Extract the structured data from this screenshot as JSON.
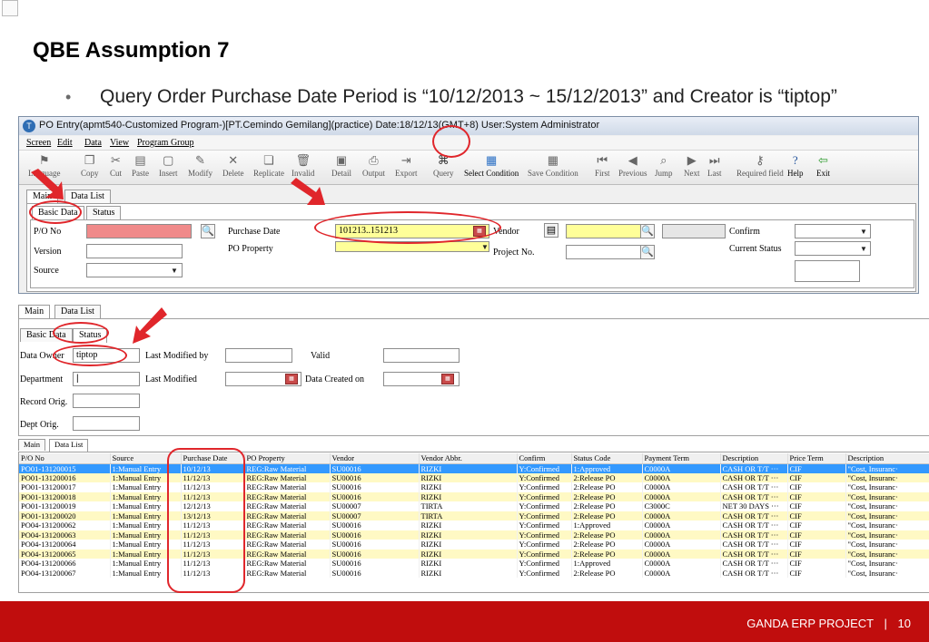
{
  "slide": {
    "title": "QBE Assumption 7",
    "bullet": "Query Order Purchase Date Period is “10/12/2013 ~ 15/12/2013” and Creator is “tiptop”",
    "footer_project": "GANDA ERP PROJECT",
    "page_number": "10"
  },
  "window": {
    "title": "PO Entry(apmt540-Customized Program-)[PT.Cemindo Gemilang](practice) Date:18/12/13(GMT+8) User:System Administrator",
    "menu": [
      "Screen",
      "Edit",
      "Data",
      "View",
      "Program Group"
    ],
    "toolbar": [
      {
        "label": "Language",
        "icon": "flag-icon"
      },
      {
        "label": "Copy",
        "icon": "copy-icon"
      },
      {
        "label": "Cut",
        "icon": "cut-icon"
      },
      {
        "label": "Paste",
        "icon": "paste-icon"
      },
      {
        "label": "Insert",
        "icon": "insert-icon"
      },
      {
        "label": "Modify",
        "icon": "pencil-icon"
      },
      {
        "label": "Delete",
        "icon": "delete-icon"
      },
      {
        "label": "Replicate",
        "icon": "replicate-icon"
      },
      {
        "label": "Invalid",
        "icon": "trash-icon"
      },
      {
        "label": "Detail",
        "icon": "detail-icon"
      },
      {
        "label": "Output",
        "icon": "printer-icon"
      },
      {
        "label": "Export",
        "icon": "export-icon"
      },
      {
        "label": "Query",
        "icon": "binoculars-icon"
      },
      {
        "label": "Select Condition",
        "icon": "select-condition-icon"
      },
      {
        "label": "Save Condition",
        "icon": "save-condition-icon"
      },
      {
        "label": "First",
        "icon": "first-icon"
      },
      {
        "label": "Previous",
        "icon": "previous-icon"
      },
      {
        "label": "Jump",
        "icon": "jump-icon"
      },
      {
        "label": "Next",
        "icon": "next-icon"
      },
      {
        "label": "Last",
        "icon": "last-icon"
      },
      {
        "label": "Required field",
        "icon": "key-icon"
      },
      {
        "label": "Help",
        "icon": "help-icon"
      },
      {
        "label": "Exit",
        "icon": "exit-icon"
      }
    ],
    "tabs": {
      "main": "Main",
      "data_list": "Data List"
    },
    "subtabs": {
      "basic": "Basic Data",
      "status": "Status"
    },
    "basic": {
      "po_no_label": "P/O No",
      "version_label": "Version",
      "source_label": "Source",
      "purchase_date_label": "Purchase Date",
      "purchase_date_value": "101213..151213",
      "po_property_label": "PO Property",
      "vendor_label": "Vendor",
      "project_label": "Project No.",
      "confirm_label": "Confirm",
      "current_status_label": "Current Status"
    }
  },
  "status_panel": {
    "tabs": {
      "main": "Main",
      "data_list": "Data List"
    },
    "subtabs": {
      "basic": "Basic Data",
      "status": "Status"
    },
    "data_owner_label": "Data Owner",
    "data_owner_value": "tiptop",
    "last_modified_by_label": "Last Modified by",
    "valid_label": "Valid",
    "department_label": "Department",
    "last_modified_label": "Last Modified",
    "data_created_label": "Data Created on",
    "record_orig_label": "Record Orig.",
    "dept_orig_label": "Dept Orig."
  },
  "data_list": {
    "tabs": {
      "main": "Main",
      "data_list": "Data List"
    },
    "columns": [
      "P/O No",
      "Source",
      "Purchase Date",
      "PO Property",
      "Vendor",
      "Vendor Abbr.",
      "Confirm",
      "Status Code",
      "Payment Term",
      "Description",
      "Price Term",
      "Description"
    ],
    "rows": [
      [
        "PO01-131200015",
        "1:Manual Entry",
        "10/12/13",
        "REG:Raw Material",
        "SU00016",
        "RIZKI",
        "Y:Confirmed",
        "1:Approved",
        "C0000A",
        "CASH OR T/T ···",
        "CIF",
        "\"Cost, Insuranc·"
      ],
      [
        "PO01-131200016",
        "1:Manual Entry",
        "11/12/13",
        "REG:Raw Material",
        "SU00016",
        "RIZKI",
        "Y:Confirmed",
        "2:Release PO",
        "C0000A",
        "CASH OR T/T ···",
        "CIF",
        "\"Cost, Insuranc·"
      ],
      [
        "PO01-131200017",
        "1:Manual Entry",
        "11/12/13",
        "REG:Raw Material",
        "SU00016",
        "RIZKI",
        "Y:Confirmed",
        "2:Release PO",
        "C0000A",
        "CASH OR T/T ···",
        "CIF",
        "\"Cost, Insuranc·"
      ],
      [
        "PO01-131200018",
        "1:Manual Entry",
        "11/12/13",
        "REG:Raw Material",
        "SU00016",
        "RIZKI",
        "Y:Confirmed",
        "2:Release PO",
        "C0000A",
        "CASH OR T/T ···",
        "CIF",
        "\"Cost, Insuranc·"
      ],
      [
        "PO01-131200019",
        "1:Manual Entry",
        "12/12/13",
        "REG:Raw Material",
        "SU00007",
        "TIRTA",
        "Y:Confirmed",
        "2:Release PO",
        "C3000C",
        "NET 30 DAYS ···",
        "CIF",
        "\"Cost, Insuranc·"
      ],
      [
        "PO01-131200020",
        "1:Manual Entry",
        "13/12/13",
        "REG:Raw Material",
        "SU00007",
        "TIRTA",
        "Y:Confirmed",
        "2:Release PO",
        "C0000A",
        "CASH OR T/T ···",
        "CIF",
        "\"Cost, Insuranc·"
      ],
      [
        "PO04-131200062",
        "1:Manual Entry",
        "11/12/13",
        "REG:Raw Material",
        "SU00016",
        "RIZKI",
        "Y:Confirmed",
        "1:Approved",
        "C0000A",
        "CASH OR T/T ···",
        "CIF",
        "\"Cost, Insuranc·"
      ],
      [
        "PO04-131200063",
        "1:Manual Entry",
        "11/12/13",
        "REG:Raw Material",
        "SU00016",
        "RIZKI",
        "Y:Confirmed",
        "2:Release PO",
        "C0000A",
        "CASH OR T/T ···",
        "CIF",
        "\"Cost, Insuranc·"
      ],
      [
        "PO04-131200064",
        "1:Manual Entry",
        "11/12/13",
        "REG:Raw Material",
        "SU00016",
        "RIZKI",
        "Y:Confirmed",
        "2:Release PO",
        "C0000A",
        "CASH OR T/T ···",
        "CIF",
        "\"Cost, Insuranc·"
      ],
      [
        "PO04-131200065",
        "1:Manual Entry",
        "11/12/13",
        "REG:Raw Material",
        "SU00016",
        "RIZKI",
        "Y:Confirmed",
        "2:Release PO",
        "C0000A",
        "CASH OR T/T ···",
        "CIF",
        "\"Cost, Insuranc·"
      ],
      [
        "PO04-131200066",
        "1:Manual Entry",
        "11/12/13",
        "REG:Raw Material",
        "SU00016",
        "RIZKI",
        "Y:Confirmed",
        "1:Approved",
        "C0000A",
        "CASH OR T/T ···",
        "CIF",
        "\"Cost, Insuranc·"
      ],
      [
        "PO04-131200067",
        "1:Manual Entry",
        "11/12/13",
        "REG:Raw Material",
        "SU00016",
        "RIZKI",
        "Y:Confirmed",
        "2:Release PO",
        "C0000A",
        "CASH OR T/T ···",
        "CIF",
        "\"Cost, Insuranc·"
      ]
    ]
  },
  "colors": {
    "annotation_red": "#e0262b",
    "footer_red": "#c00d0d",
    "selected_row": "#3399ff",
    "highlight_yellow": "#ffff99",
    "required_pink": "#f08a8a"
  }
}
